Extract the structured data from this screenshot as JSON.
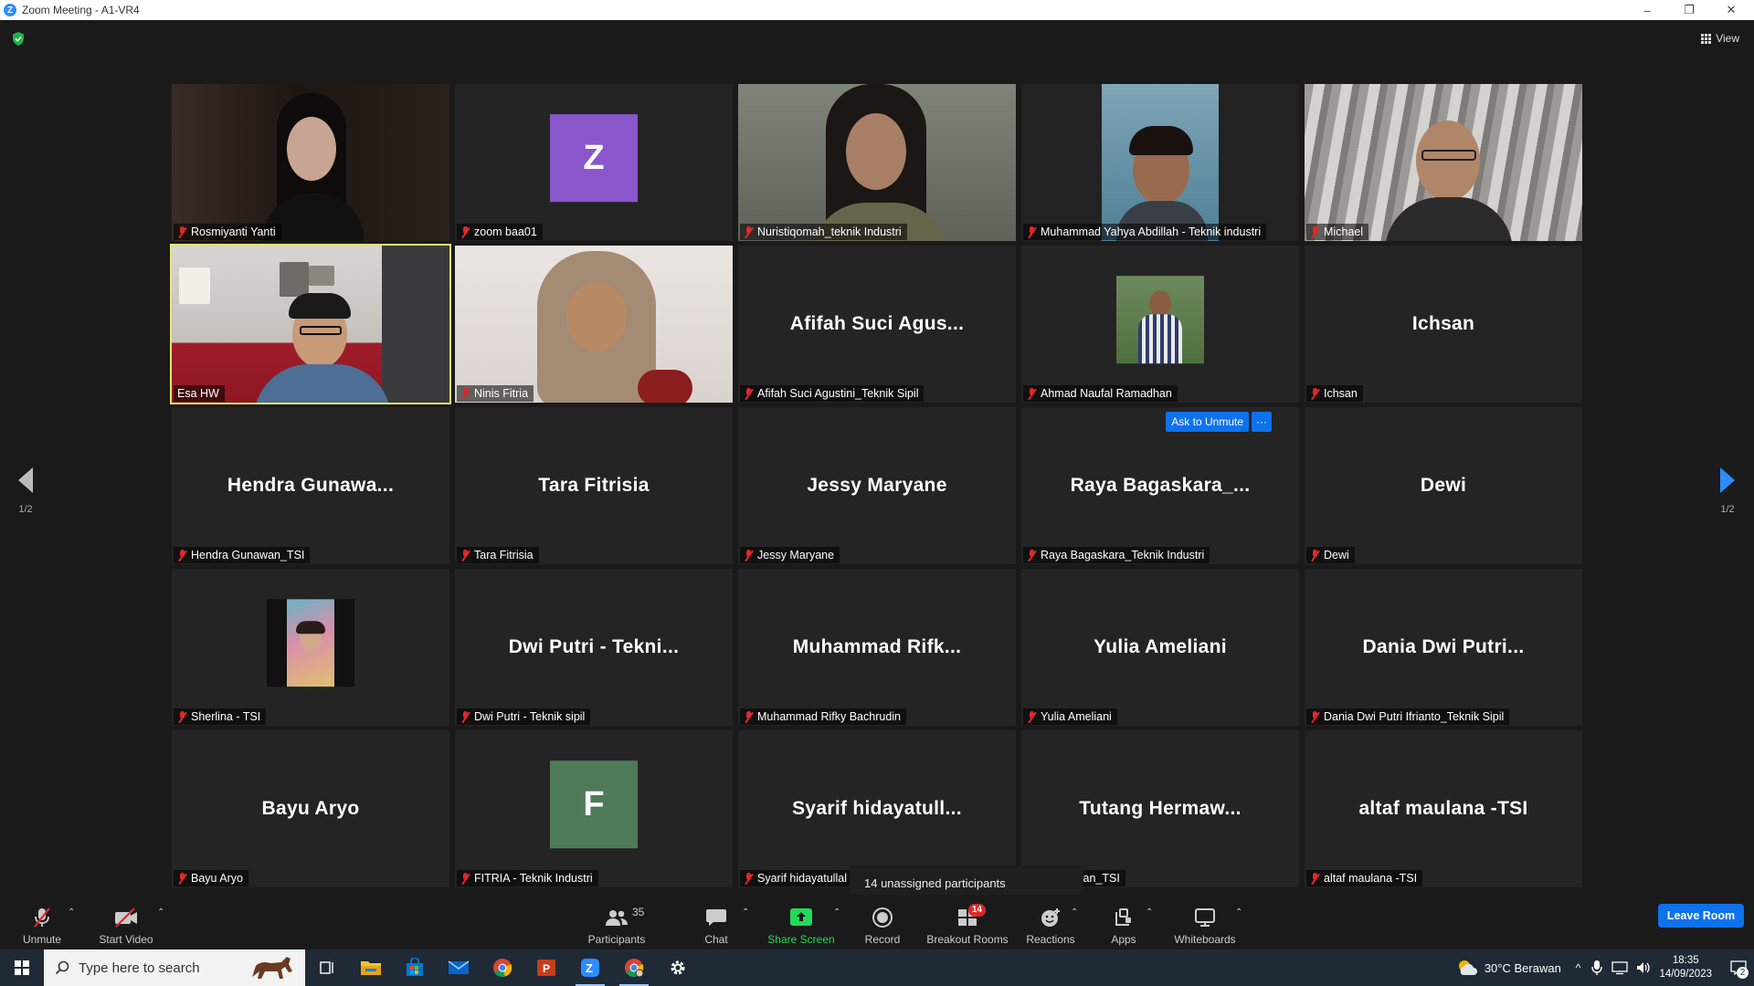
{
  "window": {
    "title": "Zoom Meeting - A1-VR4",
    "logo_letter": "Z",
    "controls": [
      "–",
      "❐",
      "✕"
    ]
  },
  "meeting": {
    "view_label": "View",
    "pager_left": "1/2",
    "pager_right": "1/2",
    "ask_to_unmute_label": "Ask to Unmute",
    "ask_more_label": "···",
    "tooltip": "14 unassigned participants"
  },
  "tiles": [
    {
      "kind": "video",
      "name": "Rosmiyanti Yanti",
      "scene": "s1"
    },
    {
      "kind": "avatar",
      "name": "zoom baa01",
      "letter": "Z",
      "color": "#8a56cc"
    },
    {
      "kind": "video",
      "name": "Nuristiqomah_teknik Industri",
      "scene": "s3"
    },
    {
      "kind": "video",
      "name": "Muhammad Yahya Abdillah - Teknik industri",
      "scene": "s4"
    },
    {
      "kind": "video",
      "name": "Michael",
      "scene": "s5"
    },
    {
      "kind": "video",
      "name": "Esa HW",
      "scene": "s6",
      "active": true,
      "unmuted": true
    },
    {
      "kind": "video",
      "name": "Ninis Fitria",
      "scene": "s7"
    },
    {
      "kind": "text",
      "name": "Afifah Suci Agustini_Teknik Sipil",
      "display": "Afifah  Suci  Agus..."
    },
    {
      "kind": "photo",
      "name": "Ahmad Naufal Ramadhan",
      "scene": "p1"
    },
    {
      "kind": "text",
      "name": "Ichsan",
      "display": "Ichsan"
    },
    {
      "kind": "text",
      "name": "Hendra Gunawan_TSI",
      "display": "Hendra  Gunawa..."
    },
    {
      "kind": "text",
      "name": "Tara Fitrisia",
      "display": "Tara Fitrisia"
    },
    {
      "kind": "text",
      "name": "Jessy Maryane",
      "display": "Jessy Maryane"
    },
    {
      "kind": "text",
      "name": "Raya Bagaskara_Teknik Industri",
      "display": "Raya  Bagaskara_...",
      "ask": true
    },
    {
      "kind": "text",
      "name": "Dewi",
      "display": "Dewi"
    },
    {
      "kind": "photo",
      "name": "Sherlina - TSI",
      "scene": "p2"
    },
    {
      "kind": "text",
      "name": "Dwi Putri - Teknik sipil",
      "display": "Dwi Putri - Tekni..."
    },
    {
      "kind": "text",
      "name": "Muhammad Rifky Bachrudin",
      "display": "Muhammad  Rifk..."
    },
    {
      "kind": "text",
      "name": "Yulia Ameliani",
      "display": "Yulia Ameliani"
    },
    {
      "kind": "text",
      "name": "Dania Dwi Putri Ifrianto_Teknik Sipil",
      "display": "Dania Dwi Putri..."
    },
    {
      "kind": "text",
      "name": "Bayu Aryo",
      "display": "Bayu Aryo"
    },
    {
      "kind": "avatar",
      "name": "FITRIA - Teknik Industri",
      "letter": "F",
      "color": "#4f7a58"
    },
    {
      "kind": "text",
      "name": "Syarif hidayatullah",
      "display": "Syarif  hidayatull...",
      "nameplate": "Syarif hidayatullal"
    },
    {
      "kind": "text",
      "name": "Tutang Hermawan_TSI",
      "display": "Tutang  Hermaw...",
      "nameplate": "Hermawan_TSI"
    },
    {
      "kind": "text",
      "name": "altaf maulana -TSI",
      "display": "altaf maulana -TSI"
    }
  ],
  "toolbar": {
    "unmute": "Unmute",
    "start_video": "Start Video",
    "participants": "Participants",
    "participants_count": "35",
    "chat": "Chat",
    "share_screen": "Share Screen",
    "record": "Record",
    "breakout_rooms": "Breakout Rooms",
    "breakout_badge": "14",
    "reactions": "Reactions",
    "apps": "Apps",
    "whiteboards": "Whiteboards",
    "leave": "Leave Room",
    "share_color": "#23d959",
    "leave_color": "#0e72ed"
  },
  "taskbar": {
    "search_placeholder": "Type here to search",
    "weather": "30°C  Berawan",
    "time": "18:35",
    "date": "14/09/2023",
    "notifications": "2"
  }
}
